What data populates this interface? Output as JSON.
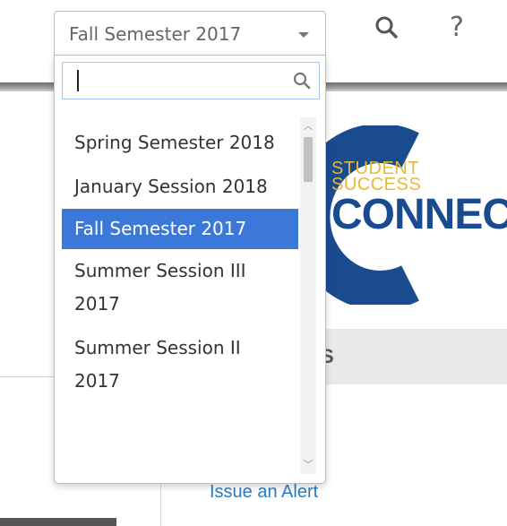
{
  "header": {
    "term_select": {
      "value": "Fall Semester 2017",
      "caret_icon": "chevron-down-icon"
    },
    "search_icon": "search-icon",
    "help_label": "?"
  },
  "dropdown": {
    "search": {
      "value": "",
      "placeholder": "",
      "icon": "search-icon"
    },
    "options": [
      {
        "label": "Spring Semester 2018",
        "selected": false
      },
      {
        "label": "January Session 2018",
        "selected": false
      },
      {
        "label": "Fall Semester 2017",
        "selected": true
      },
      {
        "label": "Summer Session III 2017",
        "selected": false
      },
      {
        "label": "Summer Session II 2017",
        "selected": false
      }
    ],
    "scrollbar": {
      "up_arrow": "︿",
      "down_arrow": "﹀"
    }
  },
  "logo": {
    "line1": "STUDENT",
    "line2": "SUCCESS",
    "line3": "CONNECT"
  },
  "page": {
    "section_label": "S",
    "issue_alert_link": "Issue an Alert"
  },
  "colors": {
    "selected_bg": "#3b78d8",
    "link": "#2a7bc4",
    "logo_blue": "#1b4b8f",
    "logo_gold": "#e8b838"
  }
}
